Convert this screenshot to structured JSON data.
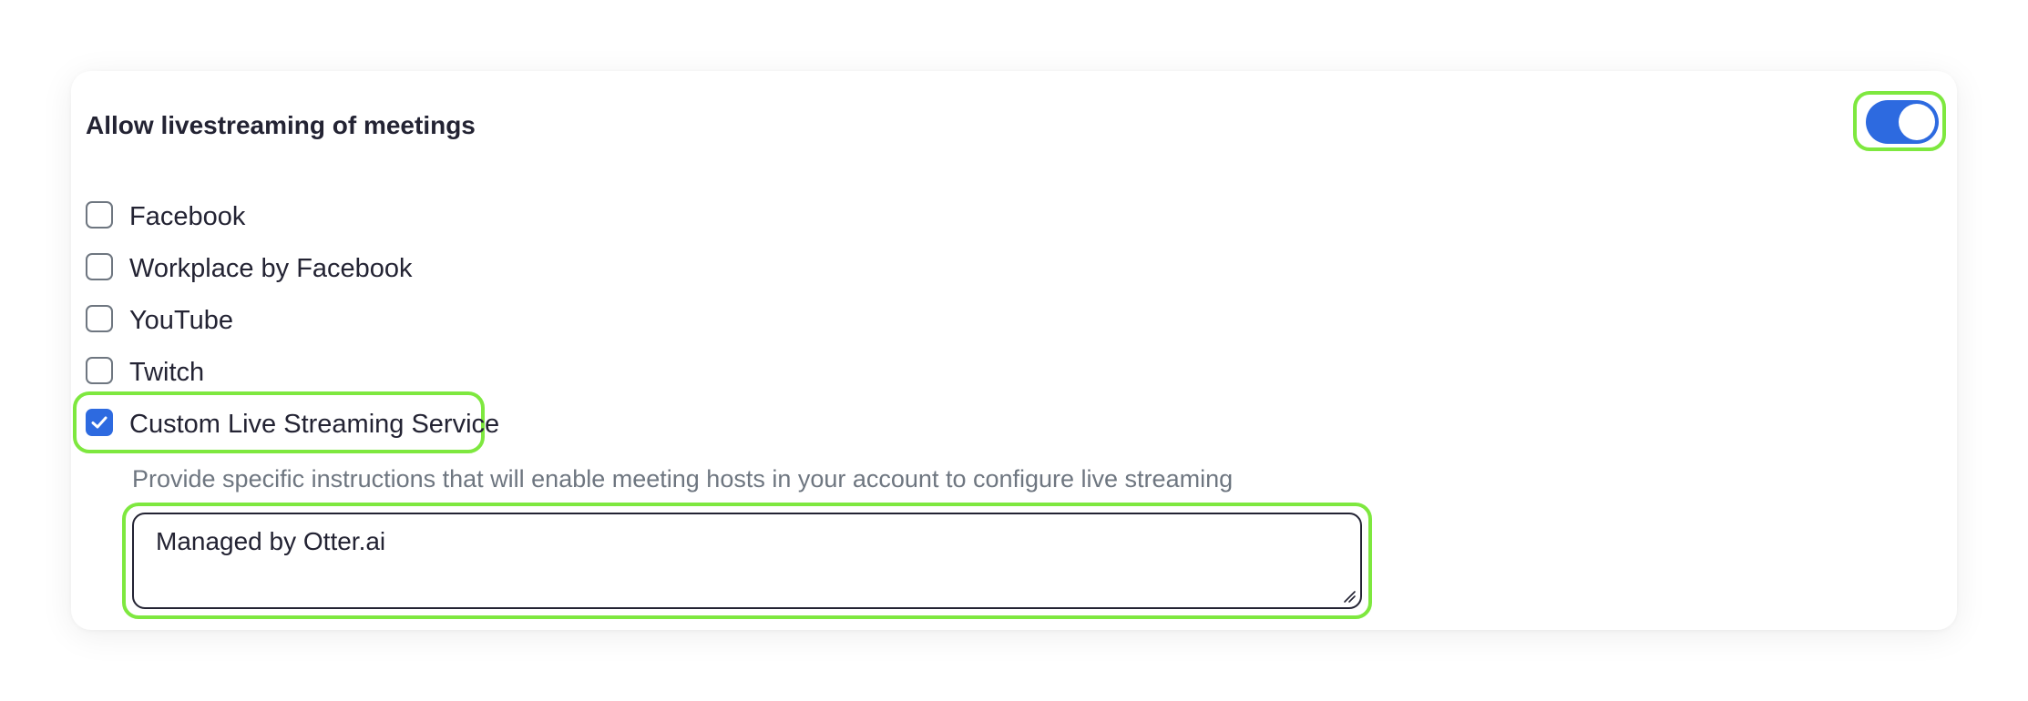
{
  "setting": {
    "title": "Allow livestreaming of meetings",
    "toggle_state": "on"
  },
  "options": [
    {
      "label": "Facebook",
      "checked": false
    },
    {
      "label": "Workplace by Facebook",
      "checked": false
    },
    {
      "label": "YouTube",
      "checked": false
    },
    {
      "label": "Twitch",
      "checked": false
    },
    {
      "label": "Custom Live Streaming Service",
      "checked": true
    }
  ],
  "custom_service": {
    "description": "Provide specific instructions that will enable meeting hosts in your account to configure live streaming",
    "instructions_value": "Managed by Otter.ai"
  },
  "colors": {
    "accent": "#2d6ae0",
    "highlight": "#7ee83f",
    "text": "#232333",
    "muted": "#6e7680"
  }
}
